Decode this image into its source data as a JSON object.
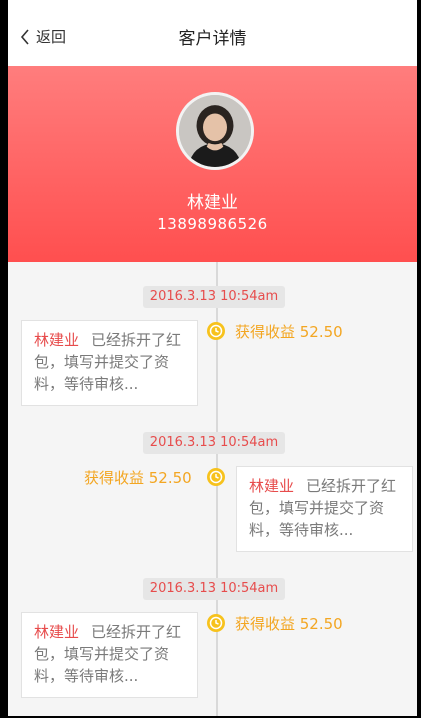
{
  "header": {
    "back_label": "返回",
    "title": "客户详情"
  },
  "profile": {
    "name": "林建业",
    "phone": "13898986526"
  },
  "colors": {
    "accent_red": "#ff5a5a",
    "earn_yellow": "#f3a622",
    "time_red": "#e74c4c"
  },
  "timeline": [
    {
      "time": "2016.3.13 10:54am",
      "earn": "获得收益 52.50",
      "actor": "林建业",
      "message": "已经拆开了红包，填写并提交了资料，等待审核...",
      "side": "left"
    },
    {
      "time": "2016.3.13 10:54am",
      "earn": "获得收益 52.50",
      "actor": "林建业",
      "message": "已经拆开了红包，填写并提交了资料，等待审核...",
      "side": "right"
    },
    {
      "time": "2016.3.13 10:54am",
      "earn": "获得收益 52.50",
      "actor": "林建业",
      "message": "已经拆开了红包，填写并提交了资料，等待审核...",
      "side": "left"
    }
  ]
}
